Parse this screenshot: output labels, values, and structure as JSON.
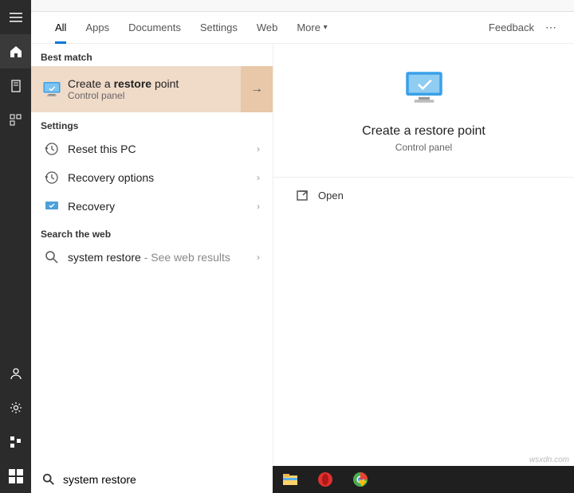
{
  "tabs": {
    "all": "All",
    "apps": "Apps",
    "documents": "Documents",
    "settings": "Settings",
    "web": "Web",
    "more": "More",
    "feedback": "Feedback"
  },
  "sections": {
    "best_match": "Best match",
    "settings": "Settings",
    "search_web": "Search the web"
  },
  "best": {
    "title_pre": "Create a ",
    "title_strong": "restore",
    "title_post": " point",
    "sub": "Control panel"
  },
  "settings_results": {
    "reset": "Reset this PC",
    "recovery_options": "Recovery options",
    "recovery": "Recovery"
  },
  "web_results": {
    "query": "system restore",
    "suffix": " - See web results"
  },
  "preview": {
    "title": "Create a restore point",
    "sub": "Control panel",
    "open": "Open"
  },
  "search": {
    "value": "system restore"
  },
  "watermark": "wsxdn.com"
}
